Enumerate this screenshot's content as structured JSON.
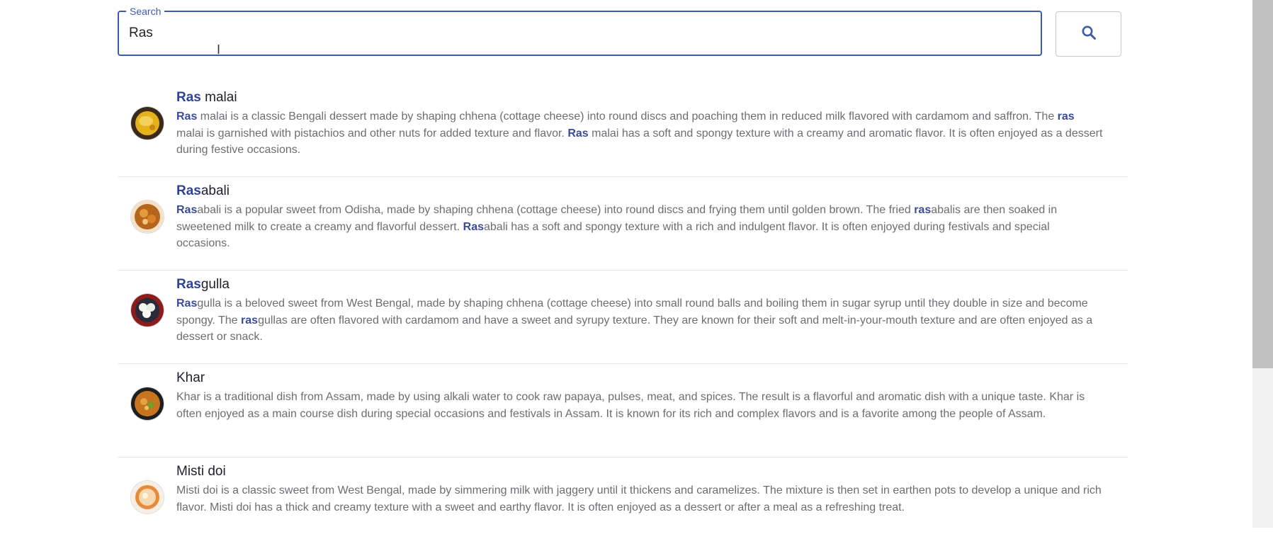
{
  "search": {
    "legend": "Search",
    "value": "Ras",
    "button_icon": "search-icon"
  },
  "results": [
    {
      "image_icon": "ras-malai-icon",
      "title": {
        "match": "Ras",
        "rest": " malai"
      },
      "description_parts": [
        {
          "t": "Ras",
          "h": true
        },
        {
          "t": " malai is a classic Bengali dessert made by shaping chhena (cottage cheese) into round discs and poaching them in reduced milk flavored with cardamom and saffron. The ",
          "h": false
        },
        {
          "t": "ras",
          "h": true
        },
        {
          "t": " malai is garnished with pistachios and other nuts for added texture and flavor. ",
          "h": false
        },
        {
          "t": "Ras",
          "h": true
        },
        {
          "t": " malai has a soft and spongy texture with a creamy and aromatic flavor. It is often enjoyed as a dessert during festive occasions.",
          "h": false
        }
      ]
    },
    {
      "image_icon": "rasabali-icon",
      "title": {
        "match": "Ras",
        "rest": "abali"
      },
      "description_parts": [
        {
          "t": "Ras",
          "h": true
        },
        {
          "t": "abali is a popular sweet from Odisha, made by shaping chhena (cottage cheese) into round discs and frying them until golden brown. The fried ",
          "h": false
        },
        {
          "t": "ras",
          "h": true
        },
        {
          "t": "abalis are then soaked in sweetened milk to create a creamy and flavorful dessert. ",
          "h": false
        },
        {
          "t": "Ras",
          "h": true
        },
        {
          "t": "abali has a soft and spongy texture with a rich and indulgent flavor. It is often enjoyed during festivals and special occasions.",
          "h": false
        }
      ]
    },
    {
      "image_icon": "rasgulla-icon",
      "title": {
        "match": "Ras",
        "rest": "gulla"
      },
      "description_parts": [
        {
          "t": "Ras",
          "h": true
        },
        {
          "t": "gulla is a beloved sweet from West Bengal, made by shaping chhena (cottage cheese) into small round balls and boiling them in sugar syrup until they double in size and become spongy. The ",
          "h": false
        },
        {
          "t": "ras",
          "h": true
        },
        {
          "t": "gullas are often flavored with cardamom and have a sweet and syrupy texture. They are known for their soft and melt-in-your-mouth texture and are often enjoyed as a dessert or snack.",
          "h": false
        }
      ]
    },
    {
      "image_icon": "khar-icon",
      "title": {
        "match": "",
        "rest": "Khar"
      },
      "description_parts": [
        {
          "t": "Khar is a traditional dish from Assam, made by using alkali water to cook raw papaya, pulses, meat, and spices. The result is a flavorful and aromatic dish with a unique taste. Khar is often enjoyed as a main course dish during special occasions and festivals in Assam. It is known for its rich and complex flavors and is a favorite among the people of Assam.",
          "h": false
        }
      ]
    },
    {
      "image_icon": "misti-doi-icon",
      "title": {
        "match": "",
        "rest": "Misti doi"
      },
      "description_parts": [
        {
          "t": "Misti doi is a classic sweet from West Bengal, made by simmering milk with jaggery until it thickens and caramelizes. The mixture is then set in earthen pots to develop a unique and rich flavor. Misti doi has a thick and creamy texture with a sweet and earthy flavor. It is often enjoyed as a dessert or after a meal as a refreshing treat.",
          "h": false
        }
      ]
    }
  ],
  "colors": {
    "accent": "#3c5bb0",
    "highlight": "#3a4a9c",
    "text_muted": "#6d6d72"
  }
}
